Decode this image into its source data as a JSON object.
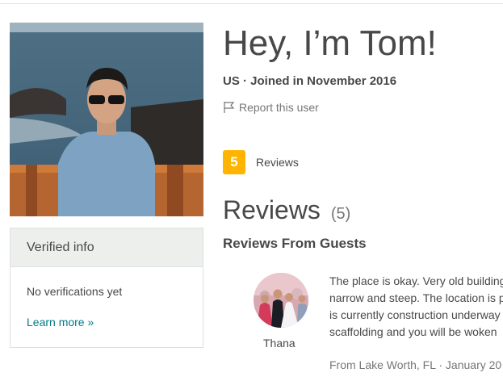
{
  "profile": {
    "greeting": "Hey, I’m Tom!",
    "meta": "US · Joined in November 2016",
    "report_label": "Report this user"
  },
  "verified": {
    "header": "Verified info",
    "status": "No verifications yet",
    "learn_more": "Learn more »"
  },
  "reviews_badge": {
    "count": "5",
    "label": "Reviews"
  },
  "reviews": {
    "title": "Reviews",
    "count": "(5)",
    "section_title": "Reviews From Guests",
    "items": [
      {
        "reviewer": "Thana",
        "text_lines": [
          "The place is okay. Very old building",
          "narrow and steep. The location is p",
          "is currently construction underway",
          "scaffolding and you will be woken"
        ],
        "from": "From Lake Worth, FL · January 20"
      }
    ]
  },
  "colors": {
    "accent_link": "#007a87",
    "badge": "#ffb400",
    "panel_header": "#edefed"
  }
}
